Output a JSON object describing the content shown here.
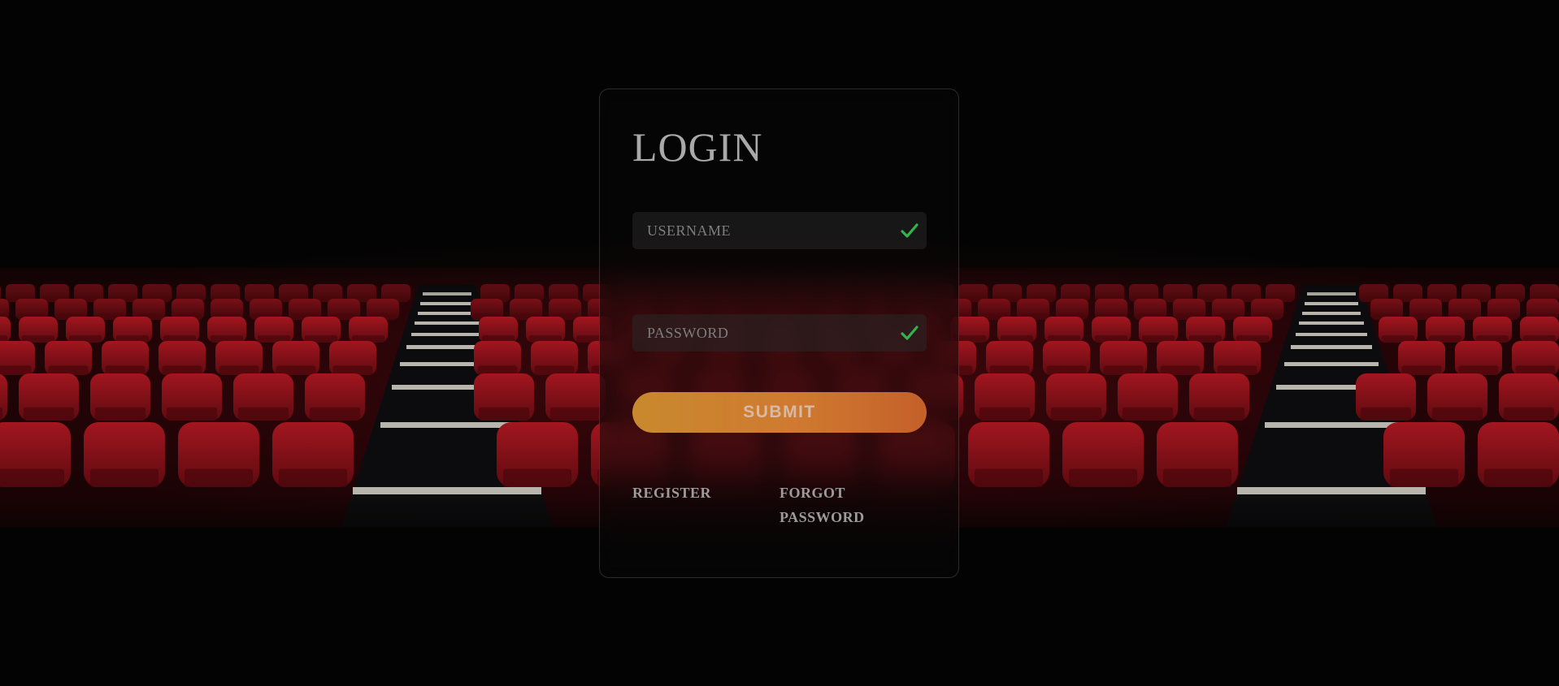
{
  "login": {
    "title": "LOGIN",
    "username": {
      "placeholder": "USERNAME",
      "value": "",
      "valid_icon": "check-icon"
    },
    "password": {
      "placeholder": "PASSWORD",
      "value": "",
      "valid_icon": "check-icon"
    },
    "submit_label": "SUBMIT",
    "register_label": "REGISTER",
    "forgot_label": "FORGOT PASSWORD"
  },
  "colors": {
    "accent_start": "#c9892e",
    "accent_end": "#c4602a",
    "valid": "#2fb54a",
    "seat": "#8e1219"
  }
}
